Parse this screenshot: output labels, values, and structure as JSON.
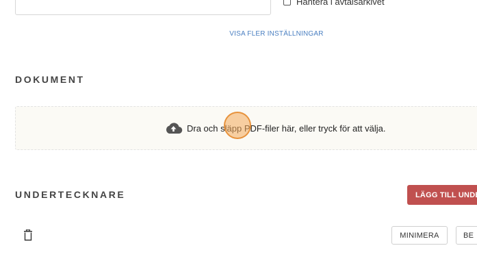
{
  "settings": {
    "archive_checkbox_label": "Hantera i avtalsarkivet",
    "show_more_link": "VISA FLER INSTÄLLNINGAR"
  },
  "documents": {
    "heading": "DOKUMENT",
    "dropzone_text": "Dra och släpp PDF-filer här, eller tryck för att välja.",
    "dropzone_icon": "cloud-upload-icon"
  },
  "signers": {
    "heading": "UNDERTECKNARE",
    "add_button": "LÄGG TILL UNDE",
    "minimize_button": "MINIMERA",
    "next_button_partial": "BE",
    "delete_icon": "trash-icon"
  },
  "colors": {
    "accent_red": "#c0504f",
    "link_blue": "#4a7fc1",
    "dropzone_bg": "#fbfaf5"
  }
}
